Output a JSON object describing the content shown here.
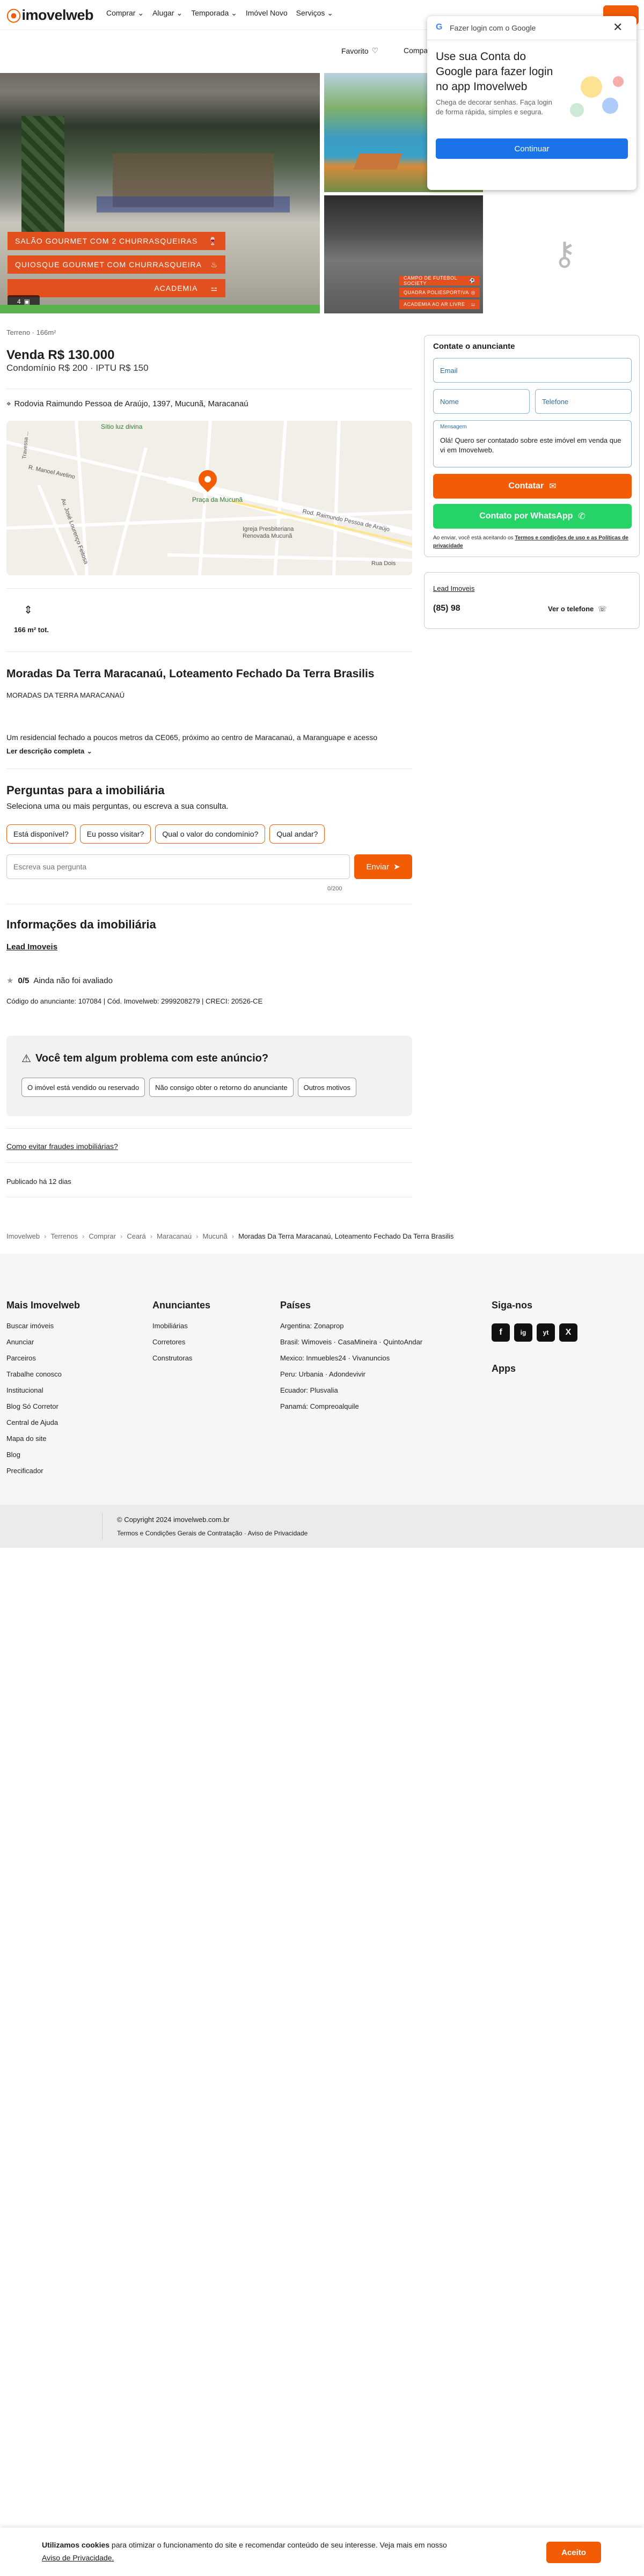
{
  "header": {
    "logo": "imovelweb",
    "nav": [
      "Comprar",
      "Alugar",
      "Temporada",
      "Imóvel Novo",
      "Serviços"
    ],
    "favorite_label": "Favorito",
    "share_label": "Compa"
  },
  "google_popup": {
    "header": "Fazer login com o Google",
    "title": "Use sua Conta do Google para fazer login no app Imovelweb",
    "body": "Chega de decorar senhas. Faça login de forma rápida, simples e segura.",
    "button": "Continuar"
  },
  "gallery": {
    "main_chips": [
      "SALÃO GOURMET COM 2 CHURRASQUEIRAS",
      "QUIOSQUE GOURMET COM CHURRASQUEIRA",
      "ACADEMIA"
    ],
    "small_chips": [
      "CAMPO DE FUTEBOL SOCIETY",
      "QUADRA POLIESPORTIVA",
      "ACADEMIA AO AR LIVRE"
    ],
    "counter": "4"
  },
  "listing": {
    "type_line": "Terreno · 166m²",
    "price": "Venda R$ 130.000",
    "fees": "Condomínio R$ 200 · IPTU R$ 150",
    "address": "Rodovia Raimundo Pessoa de Araújo, 1397, Mucunã, Maracanaú",
    "area_label": "166 m² tot.",
    "title": "Moradas Da Terra Maracanaú, Loteamento Fechado Da Terra Brasilis",
    "subtitle": "MORADAS DA TERRA MARACANAÚ",
    "description": "Um residencial fechado a poucos metros da CE065, próximo ao centro de Maracanaú, a Maranguape e acesso",
    "read_more": "Ler descrição completa"
  },
  "map": {
    "labels": [
      "Sítio luz divina",
      "R. Manoel Avelino",
      "Praça da Mucunã",
      "Rod. Raimundo Pessoa de Araújo",
      "Igreja Presbiteriana Renovada Mucunã",
      "Rua Dois",
      "Av. José Lourenço Feitosa",
      "Travessa ..."
    ]
  },
  "questions": {
    "title": "Perguntas para a imobiliária",
    "subtitle": "Seleciona uma ou mais perguntas, ou escreva a sua consulta.",
    "pills": [
      "Está disponível?",
      "Eu posso visitar?",
      "Qual o valor do condomínio?",
      "Qual andar?"
    ],
    "placeholder": "Escreva sua pergunta",
    "send_label": "Enviar",
    "counter": "0/200"
  },
  "realtor": {
    "title": "Informações da imobiliária",
    "name": "Lead Imoveis",
    "rating": "0/5",
    "rating_text": "Ainda não foi avaliado",
    "codes": "Código do anunciante: 107084 | Cód. Imovelweb: 2999208279 | CRECI: 20526-CE"
  },
  "problem": {
    "title": "Você tem algum problema com este anúncio?",
    "options": [
      "O imóvel está vendido ou reservado",
      "Não consigo obter o retorno do anunciante",
      "Outros motivos"
    ]
  },
  "fraud_link": "Como evitar fraudes imobiliárias?",
  "published": "Publicado há 12 dias",
  "breadcrumb": [
    "Imovelweb",
    "Terrenos",
    "Comprar",
    "Ceará",
    "Maracanaú",
    "Mucunã",
    "Moradas Da Terra Maracanaú, Loteamento Fechado Da Terra Brasilis"
  ],
  "contact": {
    "title": "Contate o anunciante",
    "email": "Email",
    "name": "Nome",
    "phone": "Telefone",
    "message_label": "Mensagem",
    "message": "Olá! Quero ser contatado sobre este imóvel em venda que vi em Imovelweb.",
    "contact_btn": "Contatar",
    "whatsapp_btn": "Contato por WhatsApp",
    "terms_prefix": "Ao enviar, você está aceitando os",
    "terms_link": "Termos e condições de uso e as Políticas de privacidade",
    "agent_name": "Lead Imoveis",
    "agent_phone": "(85) 98",
    "see_phone": "Ver o telefone"
  },
  "footer": {
    "col1_title": "Mais Imovelweb",
    "col1": [
      "Buscar imóveis",
      "Anunciar",
      "Parceiros",
      "Trabalhe conosco",
      "Institucional",
      "Blog Só Corretor",
      "Central de Ajuda",
      "Mapa do site",
      "Blog",
      "Precificador"
    ],
    "col2_title": "Anunciantes",
    "col2": [
      "Imobiliárias",
      "Corretores",
      "Construtoras"
    ],
    "col3_title": "Países",
    "col3": [
      "Argentina: Zonaprop",
      "Brasil: Wimoveis · CasaMineira · QuintoAndar",
      "Mexico: Inmuebles24 · Vivanuncios",
      "Peru: Urbania · Adondevivir",
      "Ecuador: Plusvalia",
      "Panamá: Compreoalquile"
    ],
    "col4_title": "Siga-nos",
    "apps_title": "Apps",
    "social": [
      "f",
      "ig",
      "yt",
      "X"
    ],
    "copyright": "© Copyright 2024 imovelweb.com.br",
    "links": "Termos e Condições Gerais de Contratação · Aviso de Privacidade"
  },
  "cookie": {
    "bold": "Utilizamos cookies",
    "text": " para otimizar o funcionamento do site e recomendar conteúdo de seu interesse. Veja mais em nosso",
    "link": "Aviso de Privacidade.",
    "button": "Aceito"
  },
  "colors": {
    "accent": "#f25c05",
    "whatsapp": "#25d366",
    "google_blue": "#1a73e8"
  }
}
